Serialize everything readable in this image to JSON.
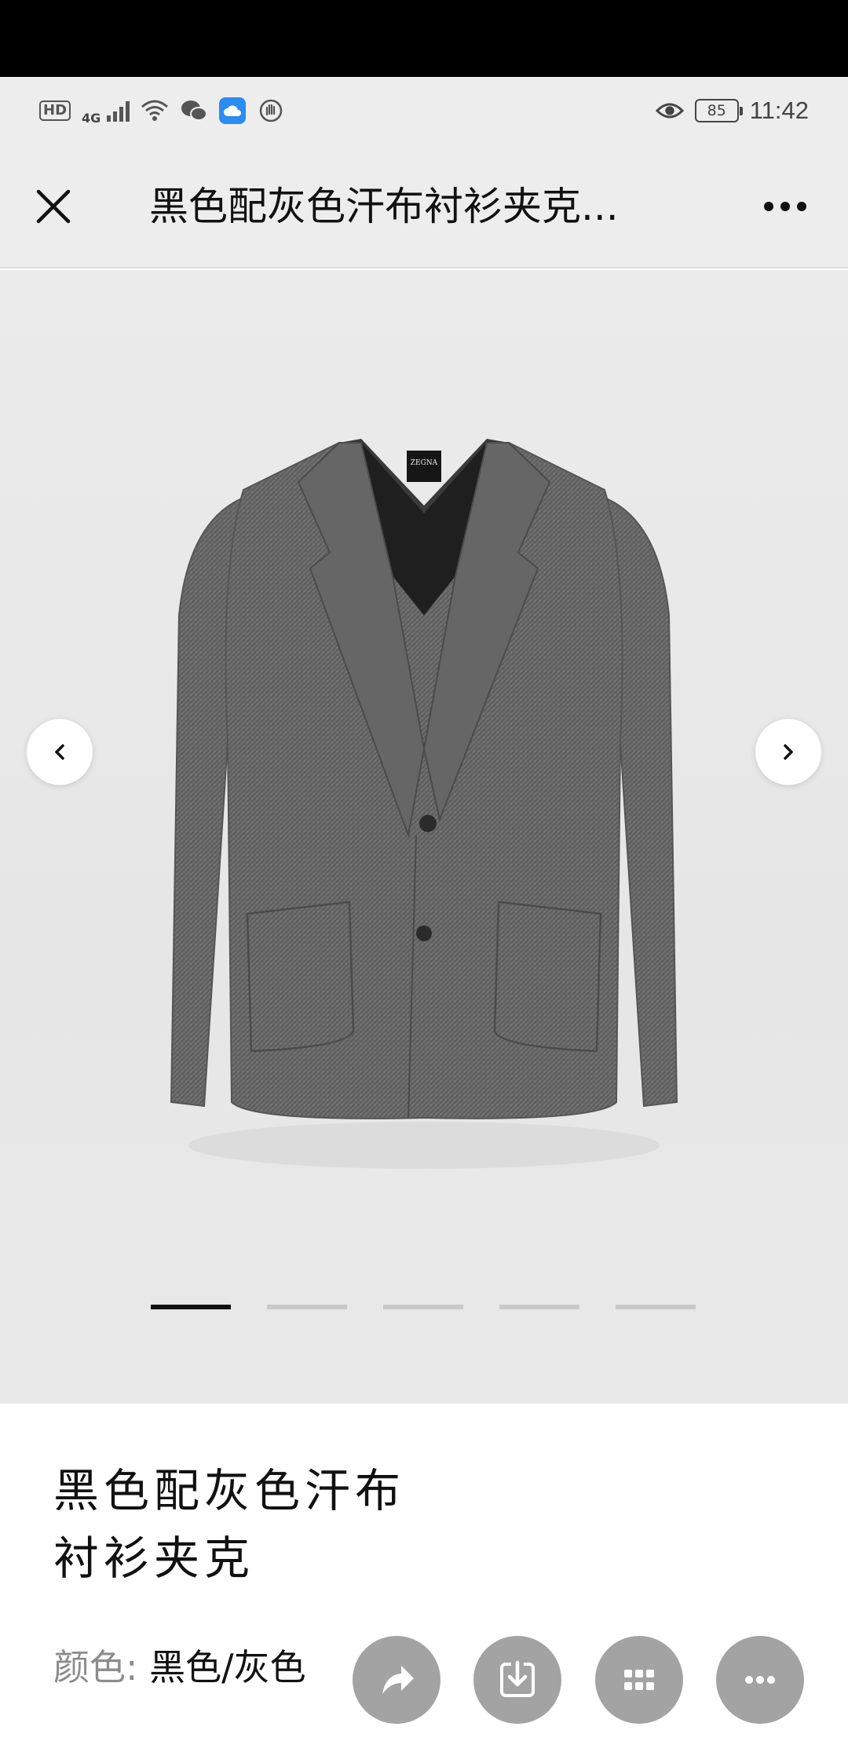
{
  "status_bar": {
    "hd_badge": "HD",
    "network": "4G",
    "battery": "85",
    "time": "11:42"
  },
  "nav": {
    "title": "黑色配灰色汗布衬衫夹克..."
  },
  "gallery": {
    "image_count": 5,
    "active_index": 0,
    "brand_label": "ZEGNA"
  },
  "product": {
    "title_line1": "黑色配灰色汗布",
    "title_line2": "衬衫夹克",
    "color_label": "颜色:",
    "color_value": "黑色/灰色"
  },
  "icons": {
    "close": "close-icon",
    "more": "more-icon",
    "prev": "chevron-left-icon",
    "next": "chevron-right-icon",
    "share": "share-icon",
    "download": "download-icon",
    "grid": "grid-icon",
    "more_actions": "more-horizontal-icon"
  },
  "colors": {
    "fab_gray": "#a3a3a3",
    "header_bg": "#ededed",
    "cloud_blue": "#2b8cf2"
  }
}
